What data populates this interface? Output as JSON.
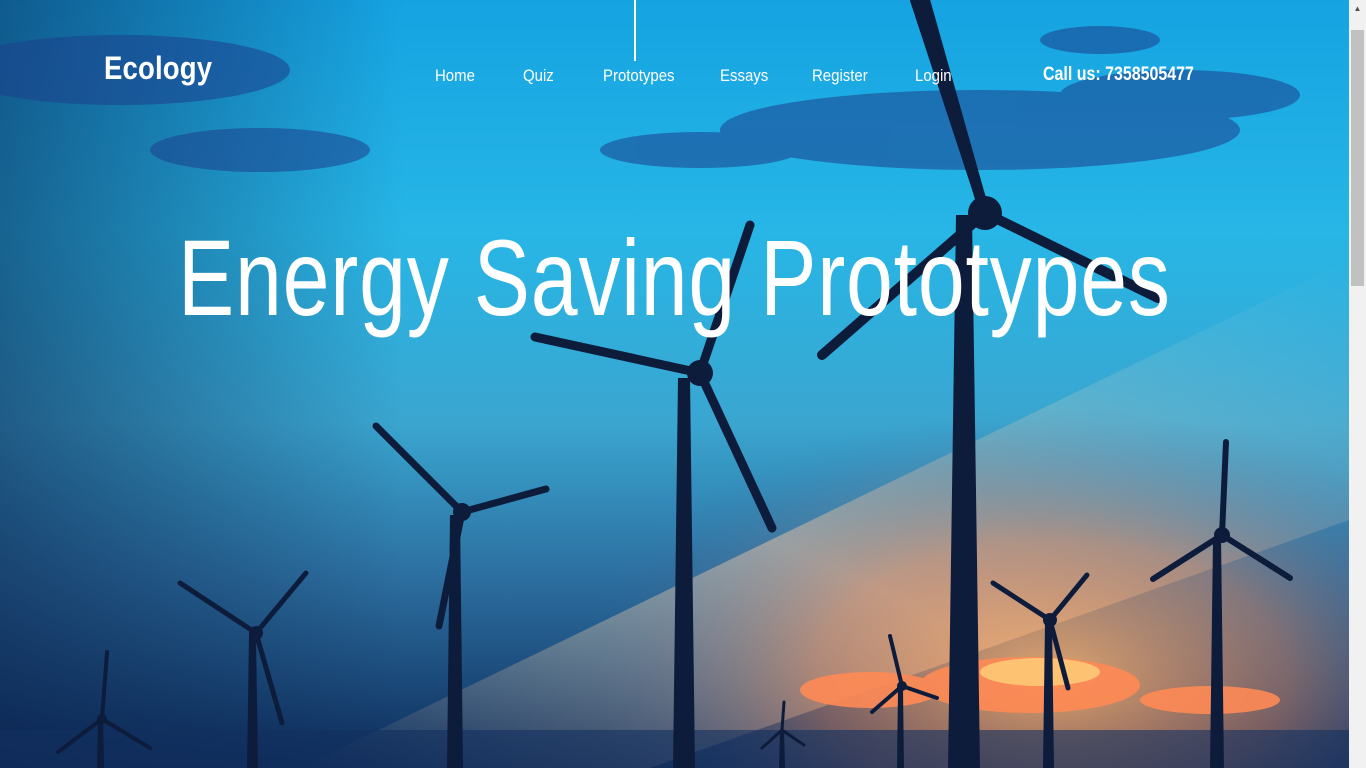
{
  "brand": "Ecology",
  "nav": {
    "items": [
      {
        "label": "Home"
      },
      {
        "label": "Quiz"
      },
      {
        "label": "Prototypes"
      },
      {
        "label": "Essays"
      },
      {
        "label": "Register"
      },
      {
        "label": "Login"
      }
    ],
    "active": "Prototypes"
  },
  "contact": {
    "phone_label": "Call us: 7358505477"
  },
  "hero": {
    "title": "Energy Saving Prototypes",
    "background": "wind-turbines-at-sunset"
  },
  "colors": {
    "sky_top": "#1aa9e6",
    "sky_mid": "#2fb3df",
    "horizon_glow": "#f2c9a0",
    "sunset_cloud": "#f07a4a",
    "turbine": "#0f1f3f",
    "text": "#ffffff"
  }
}
